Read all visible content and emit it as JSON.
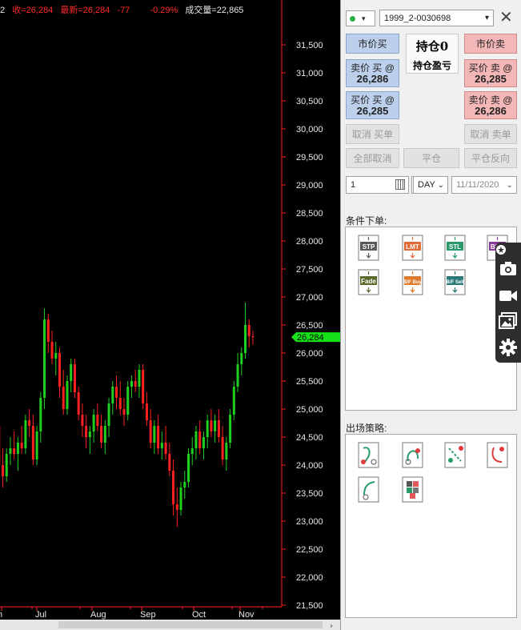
{
  "quote_bar": {
    "prefix": "2",
    "close": "收=26,284",
    "last": "最新=26,284",
    "change": "-77",
    "change_pct": "-0.29%",
    "volume": "成交量=22,865"
  },
  "colors": {
    "up": "#ff2020",
    "down": "#1fd020",
    "price_tag": "#18e018",
    "panel_bg": "#f0f0f0"
  },
  "chart_data": {
    "type": "candlestick",
    "ylim": [
      21500,
      31800
    ],
    "y_ticks": [
      "31,500",
      "31,000",
      "30,500",
      "30,000",
      "29,500",
      "29,000",
      "28,500",
      "28,000",
      "27,500",
      "27,000",
      "26,500",
      "26,000",
      "25,500",
      "25,000",
      "24,500",
      "24,000",
      "23,500",
      "23,000",
      "22,500",
      "22,000",
      "21,500"
    ],
    "x_ticks": [
      "n",
      "Jul",
      "Aug",
      "Sep",
      "Oct",
      "Nov"
    ],
    "last_price_tag": "26,284",
    "candles": [
      {
        "o": 24800,
        "h": 25100,
        "l": 24400,
        "c": 24700
      },
      {
        "o": 24700,
        "h": 24900,
        "l": 23900,
        "c": 24000
      },
      {
        "o": 24000,
        "h": 24300,
        "l": 23600,
        "c": 23800
      },
      {
        "o": 23800,
        "h": 24300,
        "l": 23700,
        "c": 24200
      },
      {
        "o": 24200,
        "h": 24500,
        "l": 24000,
        "c": 24300
      },
      {
        "o": 24300,
        "h": 24600,
        "l": 24100,
        "c": 24200
      },
      {
        "o": 24200,
        "h": 24500,
        "l": 23900,
        "c": 24400
      },
      {
        "o": 24400,
        "h": 24700,
        "l": 24200,
        "c": 24300
      },
      {
        "o": 24300,
        "h": 24900,
        "l": 24200,
        "c": 24800
      },
      {
        "o": 24800,
        "h": 25000,
        "l": 24500,
        "c": 24700
      },
      {
        "o": 24700,
        "h": 24900,
        "l": 24000,
        "c": 24100
      },
      {
        "o": 24100,
        "h": 24700,
        "l": 24000,
        "c": 24600
      },
      {
        "o": 24600,
        "h": 25300,
        "l": 24400,
        "c": 25200
      },
      {
        "o": 25200,
        "h": 26800,
        "l": 25000,
        "c": 26600
      },
      {
        "o": 26600,
        "h": 26700,
        "l": 26000,
        "c": 26200
      },
      {
        "o": 26200,
        "h": 26400,
        "l": 25800,
        "c": 25900
      },
      {
        "o": 25900,
        "h": 26200,
        "l": 25600,
        "c": 26000
      },
      {
        "o": 26000,
        "h": 26100,
        "l": 25200,
        "c": 25400
      },
      {
        "o": 25400,
        "h": 25700,
        "l": 24900,
        "c": 25000
      },
      {
        "o": 25000,
        "h": 25600,
        "l": 24900,
        "c": 25500
      },
      {
        "o": 25500,
        "h": 25900,
        "l": 25300,
        "c": 25800
      },
      {
        "o": 25800,
        "h": 25900,
        "l": 25200,
        "c": 25300
      },
      {
        "o": 25300,
        "h": 25400,
        "l": 24800,
        "c": 24900
      },
      {
        "o": 24900,
        "h": 25100,
        "l": 24500,
        "c": 24700
      },
      {
        "o": 24700,
        "h": 24900,
        "l": 24300,
        "c": 24500
      },
      {
        "o": 24500,
        "h": 24700,
        "l": 24200,
        "c": 24600
      },
      {
        "o": 24600,
        "h": 25000,
        "l": 24400,
        "c": 24900
      },
      {
        "o": 24900,
        "h": 25100,
        "l": 24600,
        "c": 24700
      },
      {
        "o": 24700,
        "h": 24900,
        "l": 24300,
        "c": 24400
      },
      {
        "o": 24400,
        "h": 24800,
        "l": 24200,
        "c": 24700
      },
      {
        "o": 24700,
        "h": 25200,
        "l": 24500,
        "c": 25100
      },
      {
        "o": 25100,
        "h": 25500,
        "l": 24900,
        "c": 25400
      },
      {
        "o": 25400,
        "h": 25600,
        "l": 25000,
        "c": 25200
      },
      {
        "o": 25200,
        "h": 25500,
        "l": 24900,
        "c": 25000
      },
      {
        "o": 25000,
        "h": 25200,
        "l": 24700,
        "c": 24900
      },
      {
        "o": 24900,
        "h": 25500,
        "l": 24800,
        "c": 25400
      },
      {
        "o": 25400,
        "h": 25600,
        "l": 25200,
        "c": 25500
      },
      {
        "o": 25500,
        "h": 25700,
        "l": 25300,
        "c": 25400
      },
      {
        "o": 25400,
        "h": 25800,
        "l": 25200,
        "c": 25700
      },
      {
        "o": 25700,
        "h": 25800,
        "l": 25000,
        "c": 25100
      },
      {
        "o": 25100,
        "h": 25300,
        "l": 24700,
        "c": 24800
      },
      {
        "o": 24800,
        "h": 25000,
        "l": 24300,
        "c": 24400
      },
      {
        "o": 24400,
        "h": 24800,
        "l": 24200,
        "c": 24700
      },
      {
        "o": 24700,
        "h": 24900,
        "l": 24200,
        "c": 24300
      },
      {
        "o": 24300,
        "h": 24600,
        "l": 24100,
        "c": 24400
      },
      {
        "o": 24400,
        "h": 24700,
        "l": 24100,
        "c": 24200
      },
      {
        "o": 24200,
        "h": 24400,
        "l": 23800,
        "c": 23900
      },
      {
        "o": 23900,
        "h": 24100,
        "l": 23100,
        "c": 23300
      },
      {
        "o": 23300,
        "h": 23600,
        "l": 22900,
        "c": 23200
      },
      {
        "o": 23200,
        "h": 23700,
        "l": 23100,
        "c": 23600
      },
      {
        "o": 23600,
        "h": 23900,
        "l": 23400,
        "c": 23700
      },
      {
        "o": 23700,
        "h": 24300,
        "l": 23600,
        "c": 24200
      },
      {
        "o": 24200,
        "h": 24500,
        "l": 24000,
        "c": 24300
      },
      {
        "o": 24300,
        "h": 24700,
        "l": 24100,
        "c": 24600
      },
      {
        "o": 24600,
        "h": 24800,
        "l": 24200,
        "c": 24300
      },
      {
        "o": 24300,
        "h": 24600,
        "l": 24100,
        "c": 24500
      },
      {
        "o": 24500,
        "h": 24900,
        "l": 24300,
        "c": 24800
      },
      {
        "o": 24800,
        "h": 25000,
        "l": 24500,
        "c": 24600
      },
      {
        "o": 24600,
        "h": 24900,
        "l": 24400,
        "c": 24800
      },
      {
        "o": 24800,
        "h": 25000,
        "l": 24400,
        "c": 24500
      },
      {
        "o": 24500,
        "h": 24700,
        "l": 24000,
        "c": 24100
      },
      {
        "o": 24100,
        "h": 24500,
        "l": 23900,
        "c": 24400
      },
      {
        "o": 24400,
        "h": 25000,
        "l": 24300,
        "c": 24900
      },
      {
        "o": 24900,
        "h": 25500,
        "l": 24800,
        "c": 25400
      },
      {
        "o": 25400,
        "h": 26000,
        "l": 25300,
        "c": 25800
      },
      {
        "o": 25800,
        "h": 26100,
        "l": 25600,
        "c": 26000
      },
      {
        "o": 26000,
        "h": 26900,
        "l": 25900,
        "c": 26500
      },
      {
        "o": 26500,
        "h": 26600,
        "l": 26100,
        "c": 26300
      },
      {
        "o": 26300,
        "h": 26400,
        "l": 26150,
        "c": 26284
      }
    ]
  },
  "panel": {
    "account": "1999_2-0030698",
    "market_buy": "市价买",
    "market_sell": "市价卖",
    "position_title": "持仓0",
    "position_pnl": "持仓盈亏",
    "bid_buy_label": "卖价 买 @",
    "bid_buy_price": "26,286",
    "ask_sell_label": "买价 卖 @",
    "ask_sell_price": "26,285",
    "bid2_buy_label": "买价 买 @",
    "bid2_buy_price": "26,285",
    "ask2_sell_label": "卖价 卖 @",
    "ask2_sell_price": "26,286",
    "cancel_buy": "取消 买单",
    "cancel_sell": "取消 卖单",
    "cancel_all": "全部取消",
    "flatten": "平仓",
    "reverse": "平仓反向",
    "quantity": "1",
    "tif": "DAY",
    "date": "11/11/2020",
    "conditional_label": "条件下单:",
    "exit_label": "出场策略:",
    "cond_icons": [
      {
        "name": "stp-order-icon",
        "text": "STP",
        "color": "#5a5a5a"
      },
      {
        "name": "lmt-order-icon",
        "text": "LMT",
        "color": "#e06a3a"
      },
      {
        "name": "stl-order-icon",
        "text": "STL",
        "color": "#2a9a6a"
      },
      {
        "name": "brk-order-icon",
        "text": "BRK",
        "color": "#8a3a9a"
      },
      {
        "name": "fade-order-icon",
        "text": "Fade",
        "color": "#5a6a2a"
      },
      {
        "name": "bfbuy-order-icon",
        "text": "B/F Buy",
        "color": "#e07a2a"
      },
      {
        "name": "bfsell-order-icon",
        "text": "B/F Sell",
        "color": "#2a7a7a"
      }
    ]
  }
}
